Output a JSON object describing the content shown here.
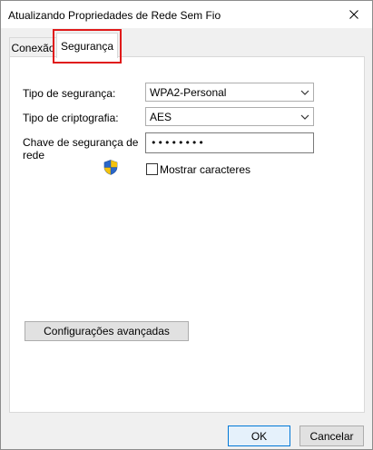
{
  "window": {
    "title": "Atualizando Propriedades de Rede Sem Fio"
  },
  "tabs": [
    {
      "label": "Conexão"
    },
    {
      "label": "Segurança",
      "selected": true
    }
  ],
  "form": {
    "security_type_label": "Tipo de segurança:",
    "security_type_value": "WPA2-Personal",
    "encryption_type_label": "Tipo de criptografia:",
    "encryption_type_value": "AES",
    "network_key_label": "Chave de segurança de rede",
    "network_key_value": "••••••••",
    "show_characters_label": "Mostrar caracteres",
    "show_characters_checked": false
  },
  "buttons": {
    "advanced": "Configurações avançadas",
    "ok": "OK",
    "cancel": "Cancelar"
  },
  "colors": {
    "highlight": "#e01a1a",
    "accent": "#0078d7"
  },
  "icons": {
    "close": "close-icon",
    "dropdown": "chevron-down-icon",
    "uac": "shield-icon"
  }
}
